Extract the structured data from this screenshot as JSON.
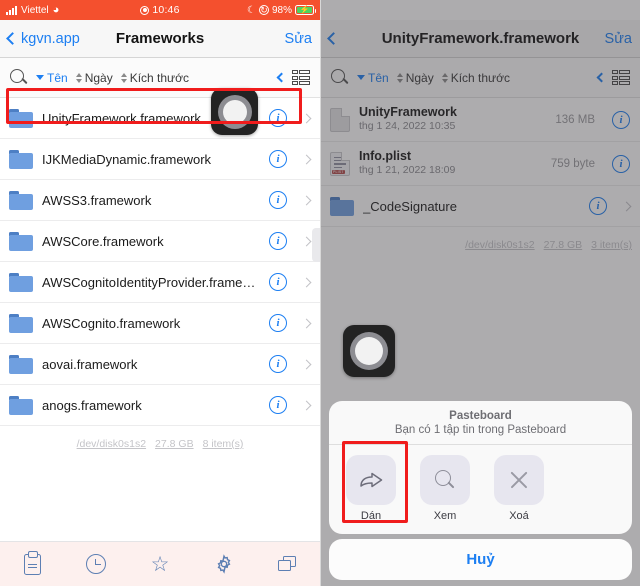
{
  "status_bar": {
    "carrier": "Viettel",
    "wifi_icon": "wifi-icon",
    "record_icon": "screen-record-icon",
    "time": "10:46",
    "moon_icon": "do-not-disturb-icon",
    "lock_icon": "rotation-lock-icon",
    "battery_percent": "98%",
    "battery_icon": "battery-charging-icon"
  },
  "left_panel": {
    "nav": {
      "back_label": "kgvn.app",
      "title": "Frameworks",
      "edit_label": "Sửa"
    },
    "sort_bar": {
      "search_icon": "search-icon",
      "name_label": "Tên",
      "date_label": "Ngày",
      "size_label": "Kích thước",
      "collapse_icon": "chevron-left-icon",
      "view_icon": "list-view-icon"
    },
    "files": [
      {
        "name": "UnityFramework.framework",
        "icon": "folder-icon",
        "highlighted": true
      },
      {
        "name": "IJKMediaDynamic.framework",
        "icon": "folder-icon",
        "highlighted": false
      },
      {
        "name": "AWSS3.framework",
        "icon": "folder-icon",
        "highlighted": false
      },
      {
        "name": "AWSCore.framework",
        "icon": "folder-icon",
        "highlighted": false
      },
      {
        "name": "AWSCognitoIdentityProvider.framework",
        "icon": "folder-icon",
        "highlighted": false
      },
      {
        "name": "AWSCognito.framework",
        "icon": "folder-icon",
        "highlighted": false
      },
      {
        "name": "aovai.framework",
        "icon": "folder-icon",
        "highlighted": false
      },
      {
        "name": "anogs.framework",
        "icon": "folder-icon",
        "highlighted": false
      }
    ],
    "footer": {
      "device": "/dev/disk0s1s2",
      "capacity": "27.8 GB",
      "count": "8 item(s)"
    },
    "tab_bar": [
      {
        "icon": "clipboard-icon"
      },
      {
        "icon": "clock-icon"
      },
      {
        "icon": "star-icon"
      },
      {
        "icon": "gear-icon"
      },
      {
        "icon": "windows-icon"
      }
    ]
  },
  "right_panel": {
    "nav": {
      "back_icon": "chevron-left-icon",
      "title": "UnityFramework.framework",
      "edit_label": "Sửa"
    },
    "sort_bar": {
      "search_icon": "search-icon",
      "name_label": "Tên",
      "date_label": "Ngày",
      "size_label": "Kích thước",
      "collapse_icon": "chevron-left-icon",
      "view_icon": "list-view-icon"
    },
    "files": [
      {
        "name": "UnityFramework",
        "date": "thg 1 24, 2022 10:35",
        "size": "136 MB",
        "icon": "document-icon"
      },
      {
        "name": "Info.plist",
        "date": "thg 1 21, 2022 18:09",
        "size": "759 byte",
        "icon": "plist-document-icon"
      },
      {
        "name": "_CodeSignature",
        "date": "",
        "size": "",
        "icon": "folder-icon"
      }
    ],
    "footer": {
      "device": "/dev/disk0s1s2",
      "capacity": "27.8 GB",
      "count": "3 item(s)"
    },
    "sheet": {
      "title": "Pasteboard",
      "subtitle": "Bạn có 1 tập tin trong Pasteboard",
      "actions": [
        {
          "label": "Dán",
          "icon": "paste-arrow-icon",
          "highlighted": true
        },
        {
          "label": "Xem",
          "icon": "search-icon",
          "highlighted": false
        },
        {
          "label": "Xoá",
          "icon": "close-x-icon",
          "highlighted": false
        }
      ],
      "cancel_label": "Huỷ"
    }
  },
  "overlays": {
    "assistive_touch_icon": "assistive-touch-button"
  },
  "colors": {
    "status_bar": "#f4502e",
    "accent": "#1d7ff2",
    "highlight": "#f01c1c",
    "folder": "#6f9fe0"
  }
}
